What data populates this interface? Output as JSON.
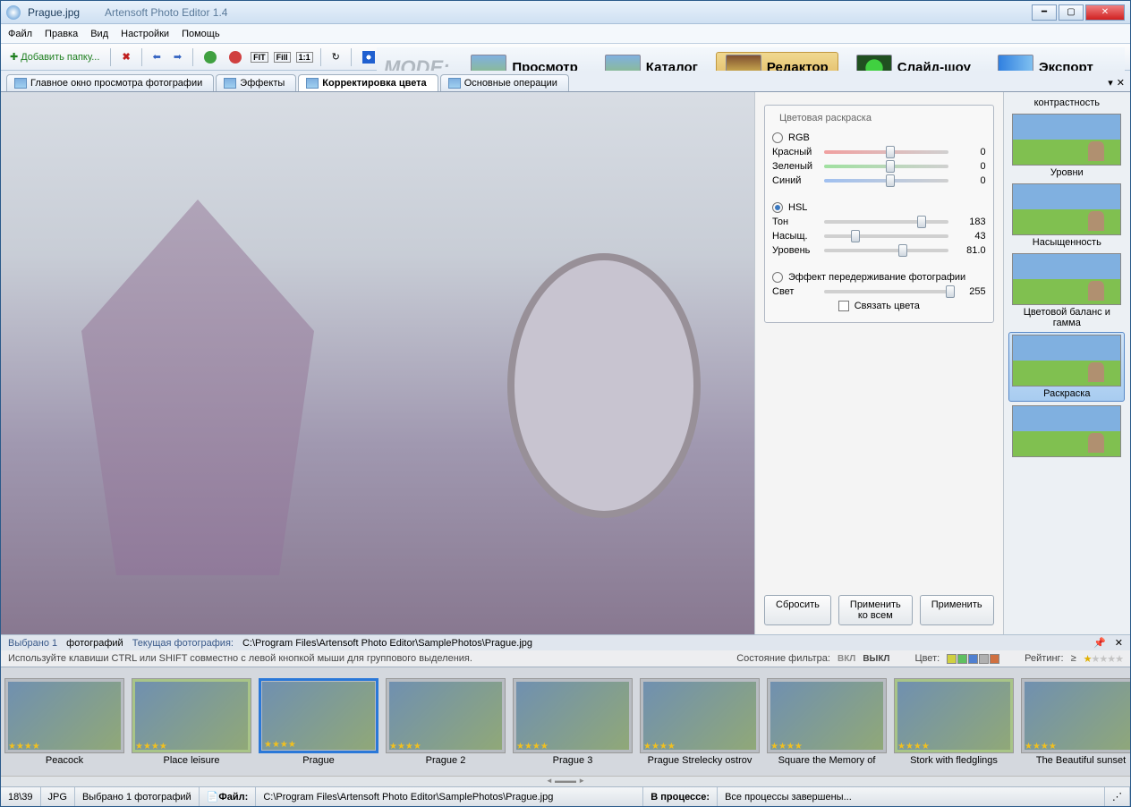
{
  "titlebar": {
    "filename": "Prague.jpg",
    "appname": "Artensoft Photo Editor 1.4"
  },
  "menu": {
    "file": "Файл",
    "edit": "Правка",
    "view": "Вид",
    "settings": "Настройки",
    "help": "Помощь"
  },
  "toolbar": {
    "add_folder": "Добавить папку...",
    "fit": "FIT",
    "fill": "Fill",
    "one_to_one": "1:1"
  },
  "modes": {
    "label": "MODE:",
    "view": "Просмотр",
    "catalog": "Каталог",
    "editor": "Редактор",
    "slideshow": "Слайд-шоу",
    "export": "Экспорт"
  },
  "tabs": {
    "main_preview": "Главное окно просмотра фотографии",
    "effects": "Эффекты",
    "color_correction": "Корректировка цвета",
    "basic_ops": "Основные операции"
  },
  "panel": {
    "title": "Цветовая раскраска",
    "rgb": {
      "label": "RGB",
      "red": "Красный",
      "green": "Зеленый",
      "blue": "Синий",
      "r": "0",
      "g": "0",
      "b": "0"
    },
    "hsl": {
      "label": "HSL",
      "hue": "Тон",
      "sat": "Насыщ.",
      "level": "Уровень",
      "h": "183",
      "s": "43",
      "l": "81.0"
    },
    "burn": {
      "label": "Эффект передерживание фотографии",
      "light_label": "Свет",
      "light": "255",
      "link": "Связать цвета"
    },
    "reset": "Сбросить",
    "apply_all": "Применить ко всем",
    "apply": "Применить"
  },
  "presets": {
    "contrast": "контрастность",
    "levels": "Уровни",
    "saturation": "Насыщенность",
    "balance": "Цветовой баланс и гамма",
    "coloring": "Раскраска"
  },
  "info": {
    "selected_label": "Выбрано 1",
    "photos": "фотографий",
    "current_label": "Текущая фотография:",
    "path": "C:\\Program Files\\Artensoft Photo Editor\\SamplePhotos\\Prague.jpg"
  },
  "hint": {
    "text": "Используйте клавиши CTRL или SHIFT совместно с левой кнопкой мыши для группового выделения.",
    "filter_state": "Состояние фильтра:",
    "on": "ВКЛ",
    "off": "ВЫКЛ",
    "color": "Цвет:",
    "rating": "Рейтинг:",
    "gte": "≥"
  },
  "thumbs": [
    {
      "label": "Peacock",
      "sel": false,
      "green": false
    },
    {
      "label": "Place leisure",
      "sel": false,
      "green": true
    },
    {
      "label": "Prague",
      "sel": true,
      "green": false
    },
    {
      "label": "Prague 2",
      "sel": false,
      "green": false
    },
    {
      "label": "Prague 3",
      "sel": false,
      "green": false
    },
    {
      "label": "Prague Strelecky ostrov",
      "sel": false,
      "green": false
    },
    {
      "label": "Square the Memory of",
      "sel": false,
      "green": false
    },
    {
      "label": "Stork with fledglings",
      "sel": false,
      "green": true
    },
    {
      "label": "The Beautiful sunset",
      "sel": false,
      "green": false
    }
  ],
  "status": {
    "pos": "18\\39",
    "format": "JPG",
    "sel": "Выбрано 1 фотографий",
    "file_label": "Файл:",
    "path": "C:\\Program Files\\Artensoft Photo Editor\\SamplePhotos\\Prague.jpg",
    "proc_label": "В процессе:",
    "proc": "Все процессы завершены..."
  }
}
